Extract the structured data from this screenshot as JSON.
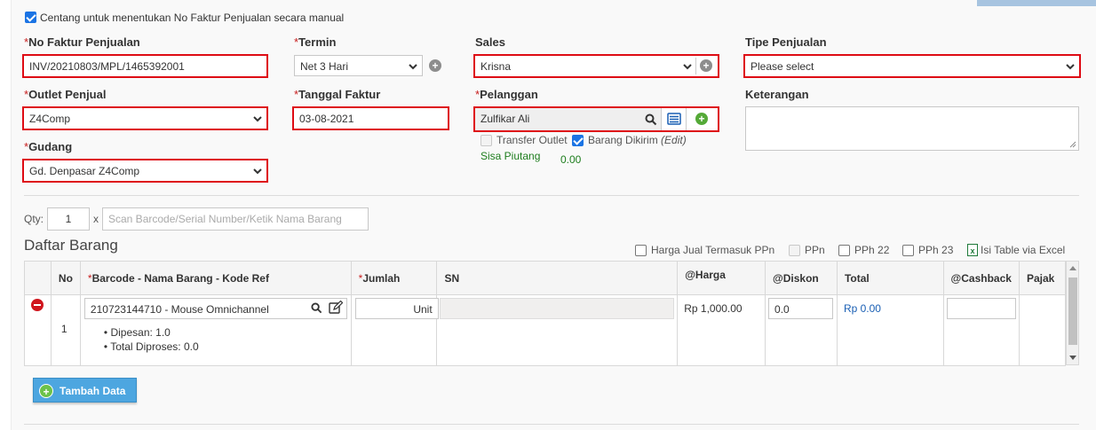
{
  "manual_invoice": {
    "checked": true,
    "label": "Centang untuk menentukan No Faktur Penjualan secara manual"
  },
  "fields": {
    "no_faktur": {
      "label": "No Faktur Penjualan",
      "value": "INV/20210803/MPL/1465392001"
    },
    "termin": {
      "label": "Termin",
      "value": "Net 3 Hari"
    },
    "sales": {
      "label": "Sales",
      "value": "Krisna"
    },
    "tipe_penjualan": {
      "label": "Tipe Penjualan",
      "value": "Please select"
    },
    "outlet_penjual": {
      "label": "Outlet Penjual",
      "value": "Z4Comp"
    },
    "tanggal_faktur": {
      "label": "Tanggal Faktur",
      "value": "03-08-2021"
    },
    "pelanggan": {
      "label": "Pelanggan",
      "value": "Zulfikar Ali"
    },
    "keterangan": {
      "label": "Keterangan",
      "value": ""
    },
    "gudang": {
      "label": "Gudang",
      "value": "Gd. Denpasar Z4Comp"
    }
  },
  "required_mark": "*",
  "transfer_outlet": {
    "label": "Transfer Outlet",
    "checked": false
  },
  "barang_dikirim": {
    "label": "Barang Dikirim",
    "checked": true,
    "edit": "(Edit)"
  },
  "sisa_piutang": {
    "label": "Sisa Piutang",
    "value": "0.00"
  },
  "scan": {
    "qty_label": "Qty:",
    "qty_value": "1",
    "x": "x",
    "placeholder": "Scan Barcode/Serial Number/Ketik Nama Barang"
  },
  "list_title": "Daftar Barang",
  "options": [
    {
      "label": "Harga Jual Termasuk PPn",
      "checked": false,
      "disabled": false
    },
    {
      "label": "PPn",
      "checked": false,
      "disabled": true
    },
    {
      "label": "PPh 22",
      "checked": false,
      "disabled": false
    },
    {
      "label": "PPh 23",
      "checked": false,
      "disabled": false
    }
  ],
  "excel_link": "Isi Table via Excel",
  "table": {
    "headers": {
      "no": "No",
      "barang": "Barcode - Nama Barang - Kode Ref",
      "jumlah": "Jumlah",
      "sn": "SN",
      "harga": "@Harga",
      "diskon": "@Diskon",
      "total": "Total",
      "cashback": "@Cashback",
      "pajak": "Pajak"
    },
    "rows": [
      {
        "no": "1",
        "barang": "210723144710 - Mouse Omnichannel",
        "dipesan": "Dipesan: 1.0",
        "diproses": "Total Diproses: 0.0",
        "jumlah_unit": "Unit",
        "harga": "Rp 1,000.00",
        "diskon": "0.0",
        "total": "Rp 0.00",
        "cashback": ""
      }
    ]
  },
  "add_button": "Tambah Data",
  "colors": {
    "highlight": "#de0b14",
    "accent_blue": "#4da6e0",
    "green": "#55a937"
  }
}
